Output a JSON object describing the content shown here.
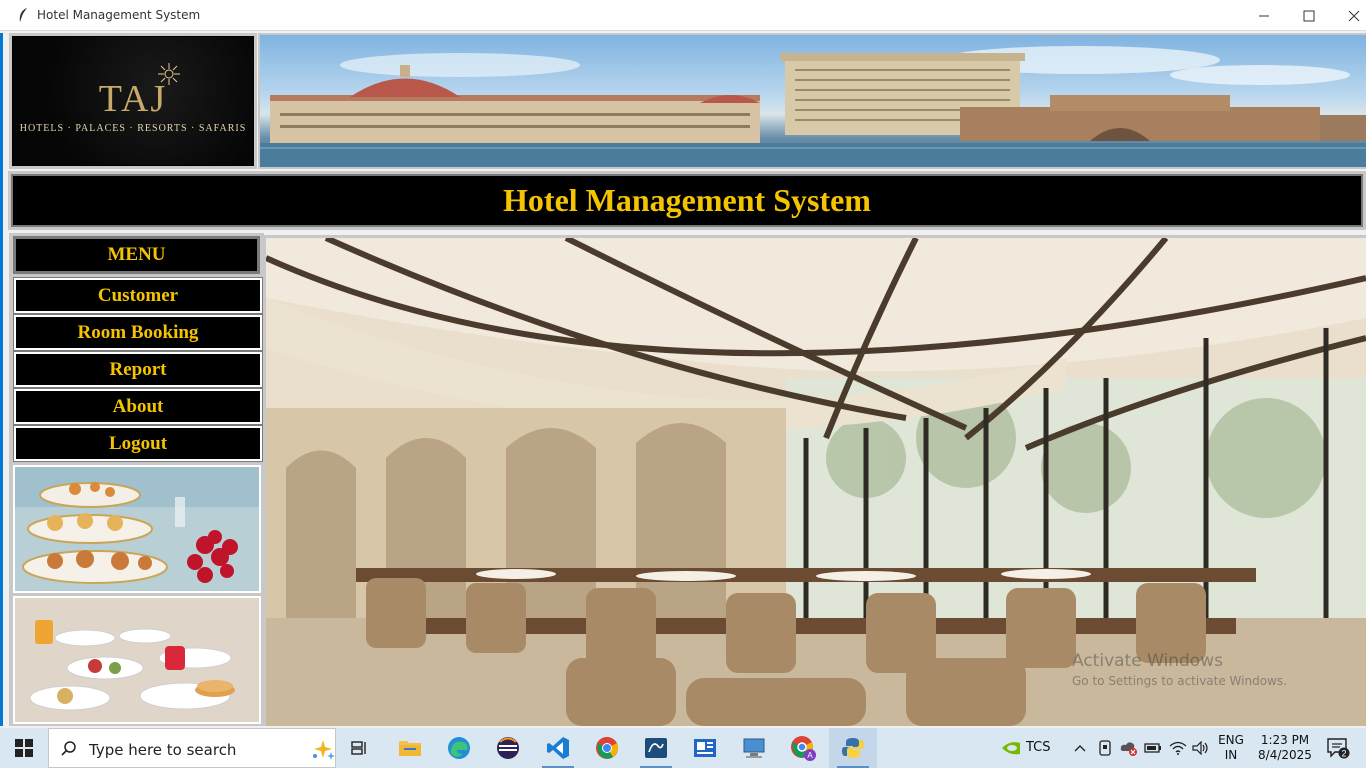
{
  "window": {
    "title": "Hotel Management System",
    "minimize_glyph": "—",
    "maximize_glyph": "☐",
    "close_glyph": "✕"
  },
  "logo": {
    "brand": "TAJ",
    "tagline": "HOTELS · PALACES · RESORTS · SAFARIS"
  },
  "header": {
    "title": "Hotel Management System"
  },
  "menu": {
    "heading": "MENU",
    "items": [
      {
        "label": "Customer"
      },
      {
        "label": "Room Booking"
      },
      {
        "label": "Report"
      },
      {
        "label": "About"
      },
      {
        "label": "Logout"
      }
    ]
  },
  "watermark": {
    "line1": "Activate Windows",
    "line2": "Go to Settings to activate Windows."
  },
  "taskbar": {
    "search_placeholder": "Type here to search",
    "tray_label": "TCS",
    "lang_line1": "ENG",
    "lang_line2": "IN",
    "time": "1:23 PM",
    "date": "8/4/2025",
    "notification_count": "2"
  },
  "colors": {
    "accent_gold": "#f5c400",
    "panel_black": "#000000",
    "frame_gray": "#c8c8c8"
  }
}
